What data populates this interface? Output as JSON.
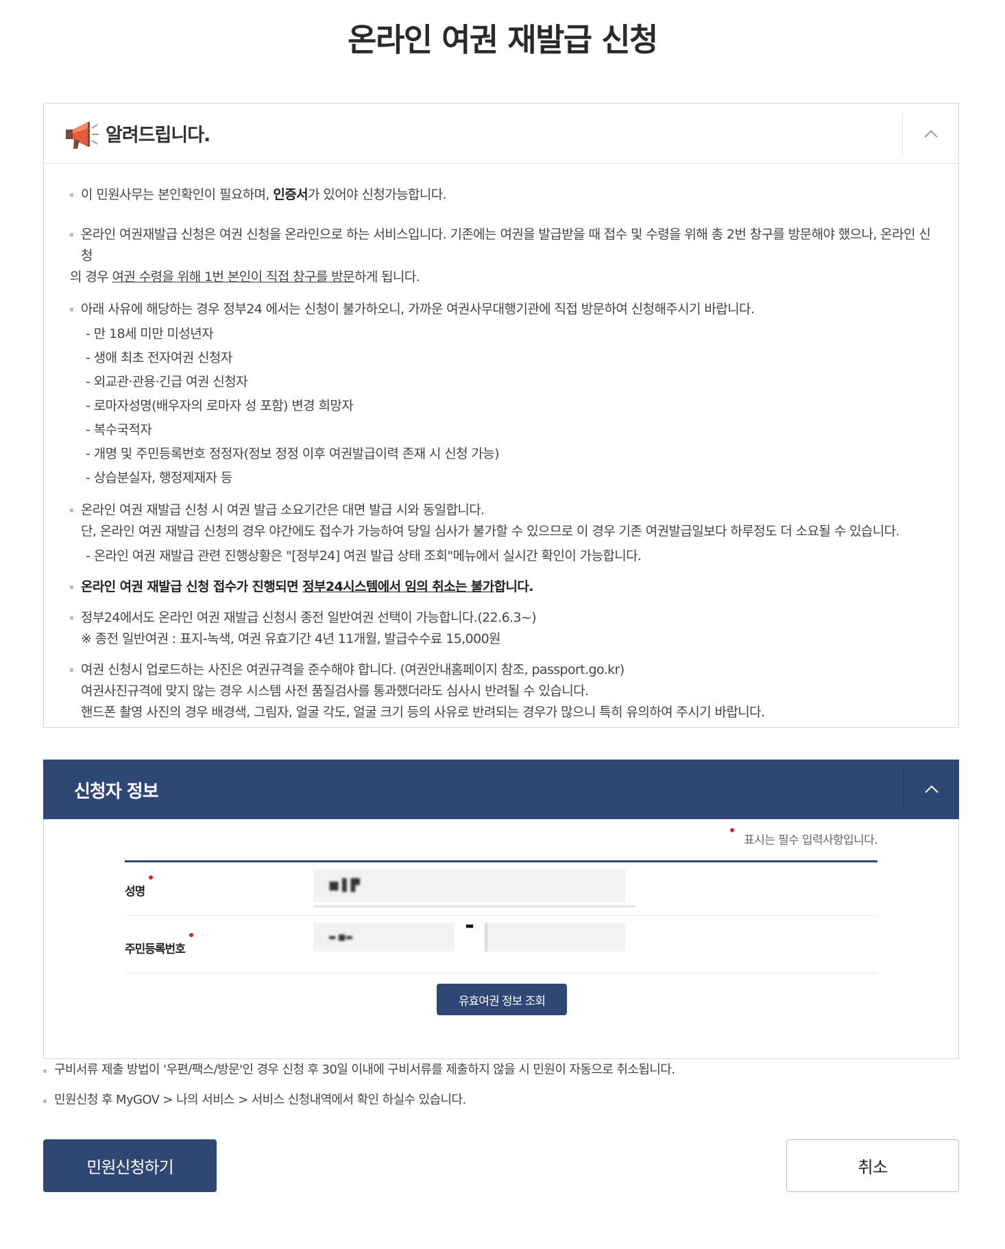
{
  "page_title": "온라인 여권 재발급 신청",
  "notice": {
    "title": "알려드립니다.",
    "item1": {
      "pre": "이 민원사무는 본인확인이 필요하며, ",
      "bold": "인증서",
      "post": "가 있어야 신청가능합니다."
    },
    "item2": {
      "line1": "온라인 여권재발급 신청은 여권 신청을 온라인으로 하는 서비스입니다. 기존에는 여권을 발급받을 때 접수 및 수령을 위해 총 2번 창구를 방문해야 했으나, 온라인 신청",
      "line2_pre": "의 경우 ",
      "line2_underline": "여권 수령을 위해 1번 본인이 직접 창구를 방문",
      "line2_post": "하게 됩니다."
    },
    "item3": {
      "line1": "아래 사유에 해당하는 경우 정부24 에서는 신청이 불가하오니, 가까운 여권사무대행기관에 직접 방문하여 신청해주시기 바랍니다.",
      "subs": [
        "- 만 18세 미만 미성년자",
        "- 생애 최초 전자여권 신청자",
        "- 외교관·관용·긴급 여권 신청자",
        "- 로마자성명(배우자의 로마자 성 포함) 변경 희망자",
        "- 복수국적자",
        "- 개명 및 주민등록번호 정정자(정보 정정 이후 여권발급이력 존재 시 신청 가능)",
        "- 상습분실자, 행정제재자 등"
      ]
    },
    "item4": {
      "line1": "온라인 여권 재발급 신청 시 여권 발급 소요기간은 대면 발급 시와 동일합니다.",
      "line2": "단, 온라인 여권 재발급 신청의 경우 야간에도 접수가 가능하여 당일 심사가 불가할 수 있으므로 이 경우 기존 여권발급일보다 하루정도 더 소요될 수 있습니다.",
      "sub": "- 온라인 여권 재발급 관련 진행상황은 \"[정부24] 여권 발급 상태 조회\"메뉴에서 실시간 확인이 가능합니다."
    },
    "item5": {
      "pre": "온라인 여권 재발급 신청 접수가 진행되면 ",
      "underline": "정부24시스템에서 임의 취소는 불가",
      "post": "합니다."
    },
    "item6": {
      "line1": "정부24에서도 온라인 여권 재발급 신청시 종전 일반여권 선택이 가능합니다.(22.6.3~)",
      "line2": "※ 종전 일반여권 : 표지-녹색, 여권 유효기간 4년 11개월, 발급수수료 15,000원"
    },
    "item7": {
      "line1": "여권 신청시 업로드하는 사진은 여권규격을 준수해야 합니다. (여권안내홈페이지 참조, passport.go.kr)",
      "line2": "여권사진규격에 맞지 않는 경우 시스템 사전 품질검사를 통과했더라도 심사시 반려될 수 있습니다.",
      "line3": "핸드폰 촬영 사진의 경우 배경색, 그림자, 얼굴 각도, 얼굴 크기 등의 사유로 반려되는 경우가 많으니 특히 유의하여 주시기 바랍니다."
    }
  },
  "applicant": {
    "title": "신청자 정보",
    "required_note": "표시는 필수 입력사항입니다.",
    "name_label": "성명",
    "name_value": "■ ▌▛",
    "rrn_label": "주민등록번호",
    "rrn_front": "▬ ■▬",
    "rrn_dash": "-",
    "rrn_back": "",
    "check_button": "유효여권 정보 조회"
  },
  "notes": [
    "구비서류 제출 방법이 '우편/팩스/방문'인 경우 신청 후 30일 이내에 구비서류를 제출하지 않을 시 민원이 자동으로 취소됩니다.",
    "민원신청 후 MyGOV > 나의 서비스 > 서비스 신청내역에서 확인 하실수 있습니다."
  ],
  "buttons": {
    "submit": "민원신청하기",
    "cancel": "취소"
  },
  "colors": {
    "brand_navy": "#2f4775",
    "required_dot": "#e0201c",
    "megaphone": "#e85a3c"
  }
}
